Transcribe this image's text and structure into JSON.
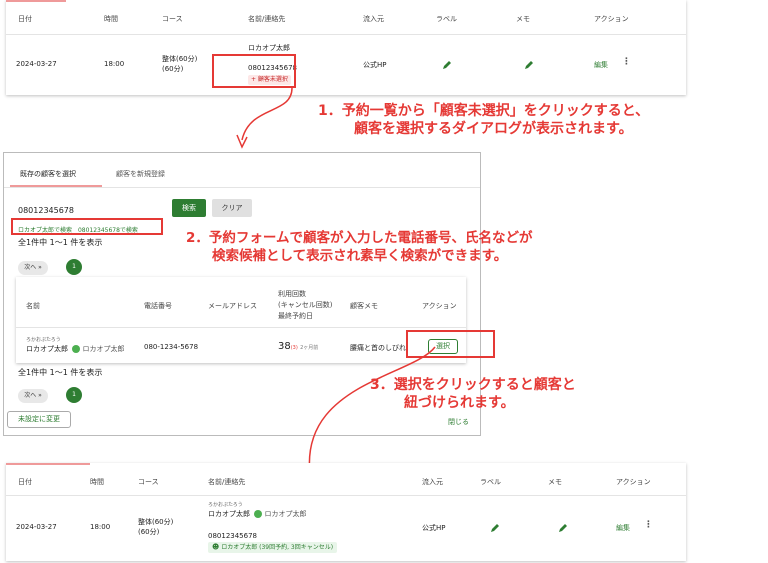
{
  "top_table": {
    "headers": [
      "日付",
      "時間",
      "コース",
      "名前/連絡先",
      "流入元",
      "ラベル",
      "メモ",
      "アクション"
    ],
    "row": {
      "date": "2024-03-27",
      "time": "18:00",
      "course_line1": "整体(60分)",
      "course_line2": "(60分)",
      "name": "ロカオプ太郎",
      "phone": "08012345678",
      "customer_tag": "+ 顧客未選択",
      "source": "公式HP",
      "edit": "編集",
      "more": "⋮"
    }
  },
  "annotations": {
    "step1_line1": "1．予約一覧から「顧客未選択」をクリックすると、",
    "step1_line2": "顧客を選択するダイアログが表示されます。",
    "step2_line1": "2．予約フォームで顧客が入力した電話番号、氏名などが",
    "step2_line2": "検索候補として表示され素早く検索ができます。",
    "step3_line1": "3．選択をクリックすると顧客と",
    "step3_line2": "紐づけられます。"
  },
  "dialog": {
    "tabs": [
      "既存の顧客を選択",
      "顧客を新規登録"
    ],
    "search_value": "08012345678",
    "search_button": "検索",
    "clear_button": "クリア",
    "suggestion_prefix": "ロカオプ太郎で検索",
    "suggestion_phone": "08012345678で検索",
    "count_text": "全1件中 1～1 件を表示",
    "next_button": "次へ »",
    "page_number": "1",
    "headers": {
      "name": "名前",
      "phone": "電話番号",
      "email": "メールアドレス",
      "usage_line1": "利用回数",
      "usage_line2": "(キャンセル回数)",
      "usage_line3": "最終予約日",
      "memo": "顧客メモ",
      "action": "アクション"
    },
    "row": {
      "kana": "ろかおぷたろう",
      "name": "ロカオプ太郎",
      "line_name": "ロカオプ太郎",
      "phone": "080-1234-5678",
      "usage_count": "38",
      "cancel_count": "(3)",
      "last_visit": "2ヶ月前",
      "memo": "腰痛と首のしびれ",
      "select_button": "選択"
    },
    "count_text_bottom": "全1件中 1～1 件を表示",
    "unset_button": "未設定に変更",
    "close_button": "閉じる"
  },
  "bottom_table": {
    "headers": [
      "日付",
      "時間",
      "コース",
      "名前/連絡先",
      "流入元",
      "ラベル",
      "メモ",
      "アクション"
    ],
    "row": {
      "date": "2024-03-27",
      "time": "18:00",
      "course_line1": "整体(60分)",
      "course_line2": "(60分)",
      "kana": "ろかおぷたろう",
      "name": "ロカオプ太郎",
      "line_name": "ロカオプ太郎",
      "phone": "08012345678",
      "customer_tag": "ロカオプ太郎 (39回予約, 3回キャンセル)",
      "source": "公式HP",
      "edit": "編集",
      "more": "⋮"
    }
  },
  "colors": {
    "accent_green": "#2e7d32",
    "annotation_red": "#e53935"
  }
}
